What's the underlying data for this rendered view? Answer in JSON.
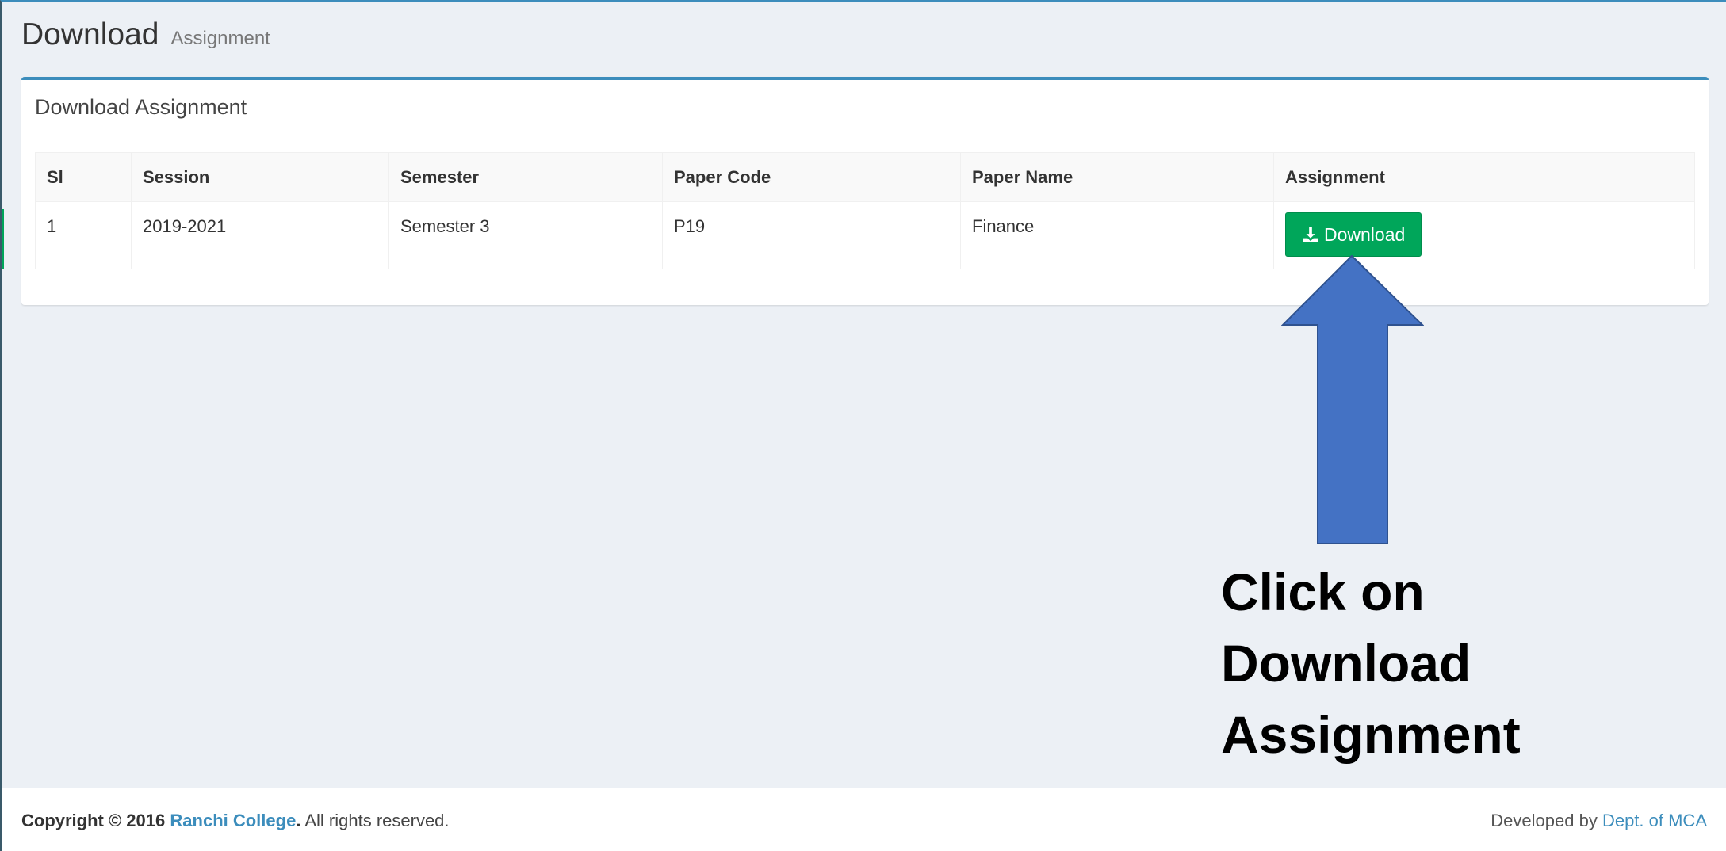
{
  "header": {
    "title": "Download",
    "subtitle": "Assignment"
  },
  "box": {
    "title": "Download Assignment"
  },
  "table": {
    "columns": [
      "Sl",
      "Session",
      "Semester",
      "Paper Code",
      "Paper Name",
      "Assignment"
    ],
    "rows": [
      {
        "sl": "1",
        "session": "2019-2021",
        "semester": "Semester 3",
        "paper_code": "P19",
        "paper_name": "Finance",
        "action_label": "Download",
        "action_icon": "download-icon"
      }
    ]
  },
  "annotation": {
    "line1": "Click on",
    "line2": "Download",
    "line3": "Assignment",
    "arrow_color": "#4472c4"
  },
  "footer": {
    "copyright_prefix": "Copyright © 2016",
    "college_link": "Ranchi College",
    "period": ".",
    "rights": "All rights reserved.",
    "developed_by": "Developed by",
    "dept_link": "Dept. of MCA"
  },
  "colors": {
    "accent": "#3c8dbc",
    "success": "#00a65a",
    "background": "#ecf0f5"
  }
}
